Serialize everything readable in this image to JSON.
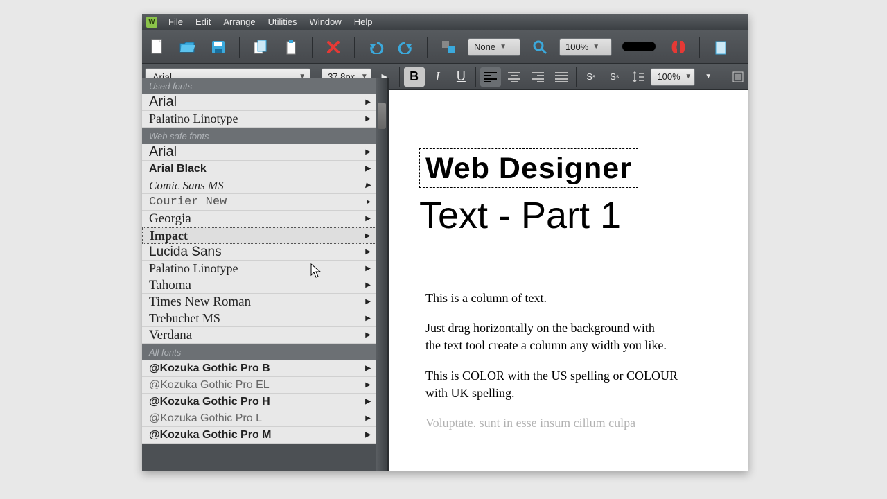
{
  "menus": [
    "File",
    "Edit",
    "Arrange",
    "Utilities",
    "Window",
    "Help"
  ],
  "toolbar1": {
    "snap": "None",
    "zoom": "100%"
  },
  "toolbar2": {
    "font": "Arial",
    "size": "37,8px",
    "line_spacing": "100%"
  },
  "dropdown": {
    "sections": {
      "used": "Used fonts",
      "websafe": "Web safe fonts",
      "all": "All fonts"
    },
    "used_fonts": [
      "Arial",
      "Palatino Linotype"
    ],
    "websafe_fonts": [
      "Arial",
      "Arial Black",
      "Comic Sans MS",
      "Courier New",
      "Georgia",
      "Impact",
      "Lucida Sans",
      "Palatino Linotype",
      "Tahoma",
      "Times New Roman",
      "Trebuchet MS",
      "Verdana"
    ],
    "all_fonts": [
      "@Kozuka Gothic Pro B",
      "@Kozuka Gothic Pro EL",
      "@Kozuka Gothic Pro H",
      "@Kozuka Gothic Pro L",
      "@Kozuka Gothic Pro M"
    ],
    "hovered": "Impact"
  },
  "canvas": {
    "title": "Web Designer",
    "subtitle": "Text - Part 1",
    "paragraphs": [
      "This is a column of text.",
      "Just drag horizontally on the background with",
      "the text tool create a column any width you like.",
      "This is COLOR with the US spelling or COLOUR with UK spelling.",
      "Voluptate. sunt in esse insum cillum culpa"
    ]
  }
}
